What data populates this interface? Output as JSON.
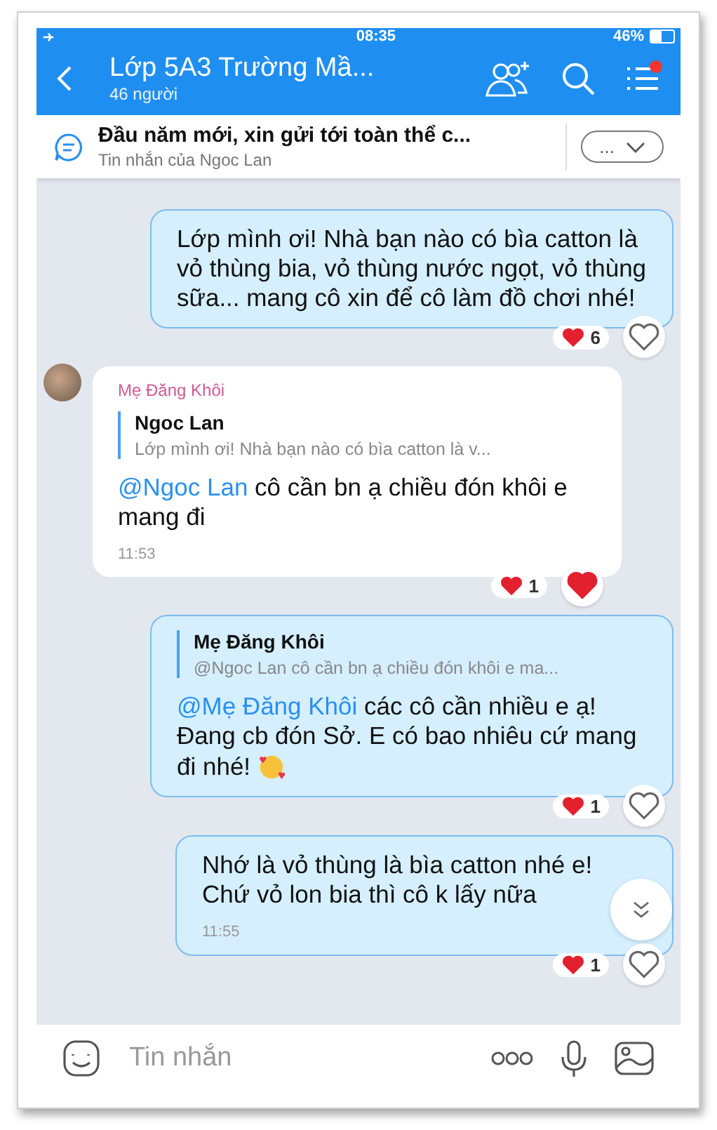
{
  "status_bar": {
    "time": "08:35",
    "battery": "46%"
  },
  "header": {
    "title": "Lớp 5A3 Trường Mầ...",
    "subtitle": "46 người",
    "notification_dot": true
  },
  "pinned": {
    "title": "Đầu năm mới, xin gửi tới toàn thể c...",
    "subtitle": "Tin nhắn của Ngoc Lan",
    "button": "..."
  },
  "messages": [
    {
      "kind": "outgoing",
      "text": "Lớp mình ơi! Nhà bạn nào có bìa catton là vỏ thùng bia, vỏ thùng nước ngọt, vỏ thùng sữa... mang cô xin để cô làm đồ chơi nhé!",
      "reactions": {
        "count": "6",
        "reacted": false
      }
    },
    {
      "kind": "incoming",
      "sender": "Mẹ Đăng Khôi",
      "quote": {
        "author": "Ngoc Lan",
        "text": "Lớp mình ơi! Nhà bạn nào có bìa catton là v..."
      },
      "mention": "@Ngoc Lan",
      "text": " cô cần bn ạ chiều đón khôi e mang đi",
      "time": "11:53",
      "reactions": {
        "count": "1",
        "reacted": true
      }
    },
    {
      "kind": "outgoing",
      "quote": {
        "author": "Mẹ Đăng Khôi",
        "text": "@Ngoc Lan cô cần bn ạ chiều đón khôi e ma..."
      },
      "mention": "@Mẹ Đăng Khôi",
      "text": " các cô cần nhiều e ạ! Đang cb đón Sở. E có bao nhiêu cứ mang đi nhé!",
      "emoji": true,
      "reactions": {
        "count": "1",
        "reacted": false
      }
    },
    {
      "kind": "outgoing",
      "text": "Nhớ là vỏ thùng là bìa catton nhé e! Chứ vỏ lon bia thì cô k lấy nữa",
      "time": "11:55",
      "reactions": {
        "count": "1",
        "reacted": false
      }
    }
  ],
  "composer": {
    "placeholder": "Tin nhắn"
  }
}
